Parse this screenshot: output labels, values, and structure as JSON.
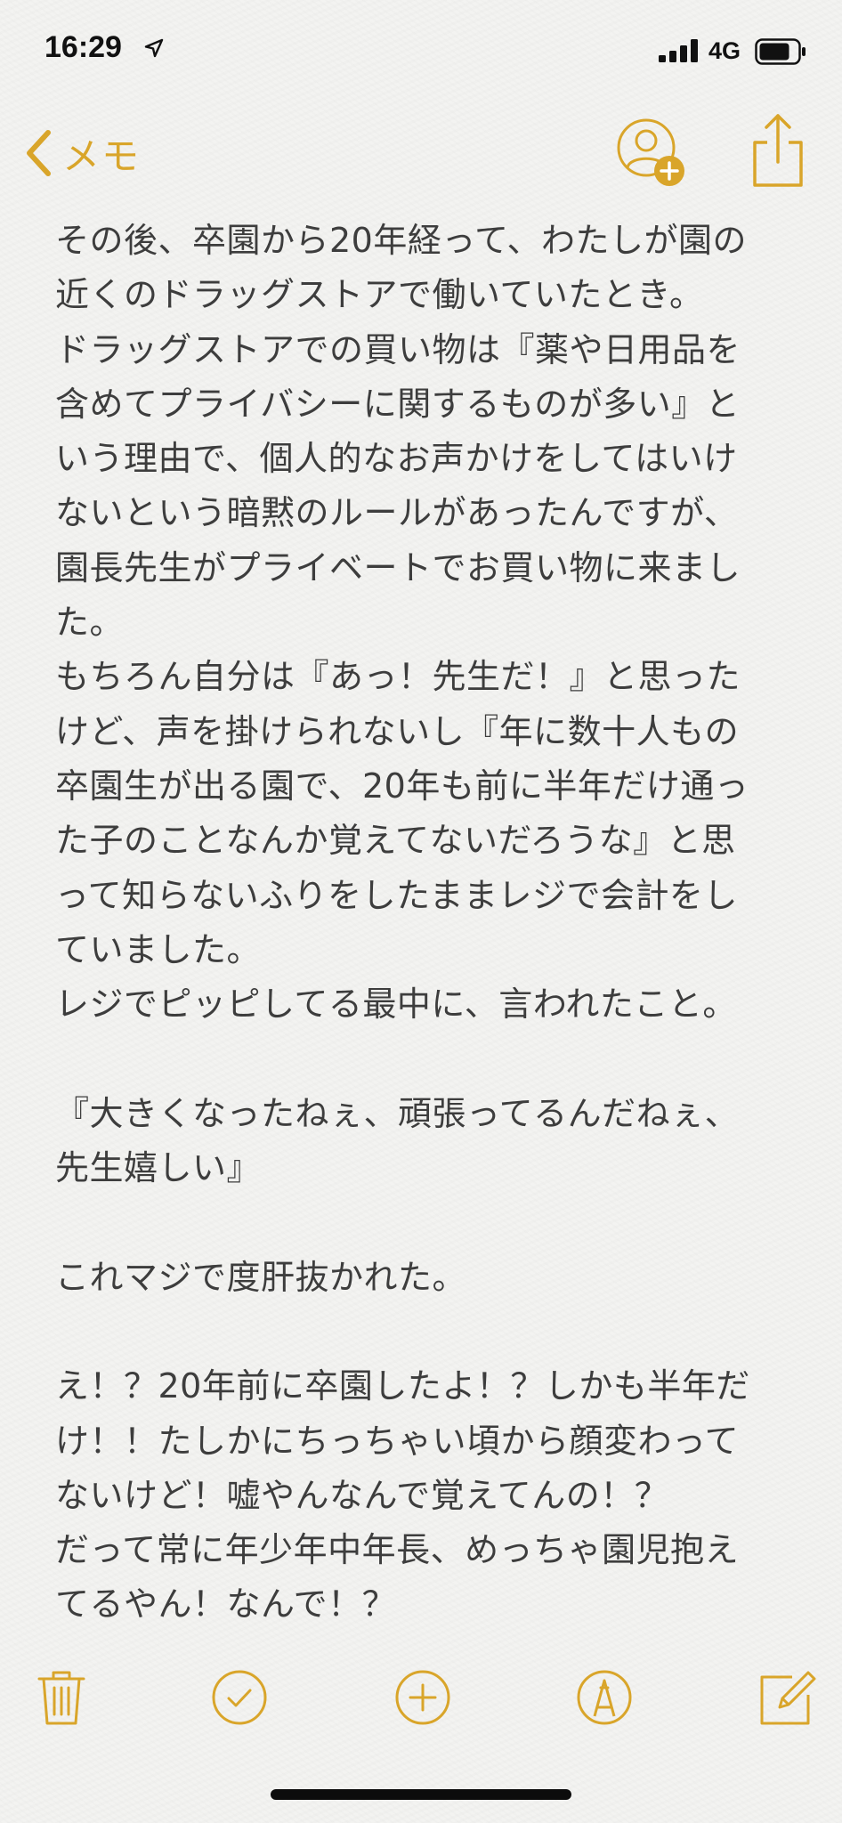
{
  "status_bar": {
    "time": "16:29",
    "network": "4G",
    "location_icon": "location-arrow-icon",
    "signal_icon": "cellular-signal-icon",
    "battery_icon": "battery-icon",
    "battery_level": 0.75
  },
  "nav": {
    "back_label": "メモ",
    "back_icon": "chevron-left-icon",
    "add_person_icon": "add-person-icon",
    "share_icon": "share-icon"
  },
  "colors": {
    "accent": "#d9a52a",
    "text": "#3d3d3d",
    "background": "#f3f3f1"
  },
  "note": {
    "lines": [
      "その後、卒園から20年経って、わたしが園の",
      "近くのドラッグストアで働いていたとき。",
      "ドラッグストアでの買い物は『薬や日用品を",
      "含めてプライバシーに関するものが多い』と",
      "いう理由で、個人的なお声かけをしてはいけ",
      "ないという暗黙のルールがあったんですが、",
      "園長先生がプライベートでお買い物に来まし",
      "た。",
      "もちろん自分は『あっ！先生だ！』と思った",
      "けど、声を掛けられないし『年に数十人もの",
      "卒園生が出る園で、20年も前に半年だけ通っ",
      "た子のことなんか覚えてないだろうな』と思",
      "って知らないふりをしたままレジで会計をし",
      "ていました。",
      "レジでピッピしてる最中に、言われたこと。",
      "",
      "『大きくなったねぇ、頑張ってるんだねぇ、",
      "先生嬉しい』",
      "",
      "これマジで度肝抜かれた。",
      "",
      "え！？20年前に卒園したよ！？しかも半年だ",
      "け！！たしかにちっちゃい頃から顔変わって",
      "ないけど！嘘やんなんで覚えてんの！？",
      "だって常に年少年中年長、めっちゃ園児抱え",
      "てるやん！なんで！？"
    ]
  },
  "toolbar": {
    "items": [
      {
        "icon": "trash-icon"
      },
      {
        "icon": "checklist-icon"
      },
      {
        "icon": "add-icon"
      },
      {
        "icon": "markup-pen-icon"
      },
      {
        "icon": "compose-icon"
      }
    ]
  }
}
